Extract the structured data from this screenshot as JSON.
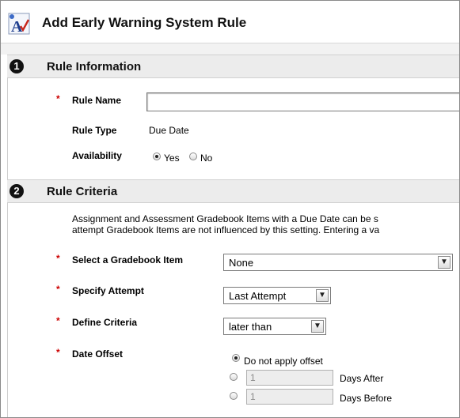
{
  "page": {
    "title": "Add Early Warning System Rule"
  },
  "section1": {
    "number": "1",
    "title": "Rule Information",
    "rule_name_label": "Rule Name",
    "rule_name_value": "",
    "rule_type_label": "Rule Type",
    "rule_type_value": "Due Date",
    "availability_label": "Availability",
    "availability_options": [
      {
        "label": "Yes",
        "selected": true
      },
      {
        "label": "No",
        "selected": false
      }
    ]
  },
  "section2": {
    "number": "2",
    "title": "Rule Criteria",
    "description_line1": "Assignment and Assessment Gradebook Items with a Due Date can be s",
    "description_line2": "attempt Gradebook Items are not influenced by this setting. Entering a va",
    "gradebook_item_label": "Select a Gradebook Item",
    "gradebook_item_value": "None",
    "attempt_label": "Specify Attempt",
    "attempt_value": "Last Attempt",
    "criteria_label": "Define Criteria",
    "criteria_value": "later than",
    "offset_label": "Date Offset",
    "offset_options": [
      {
        "label": "Do not apply offset",
        "selected": true
      },
      {
        "label": "Days After",
        "value": "1",
        "selected": false
      },
      {
        "label": "Days Before",
        "value": "1",
        "selected": false
      }
    ]
  },
  "required_marker": "*",
  "colors": {
    "required": "#cc0000",
    "section_header_bg": "#ececec"
  },
  "icons": {
    "app": "spell-check-icon",
    "dropdown": "chevron-down-icon"
  }
}
